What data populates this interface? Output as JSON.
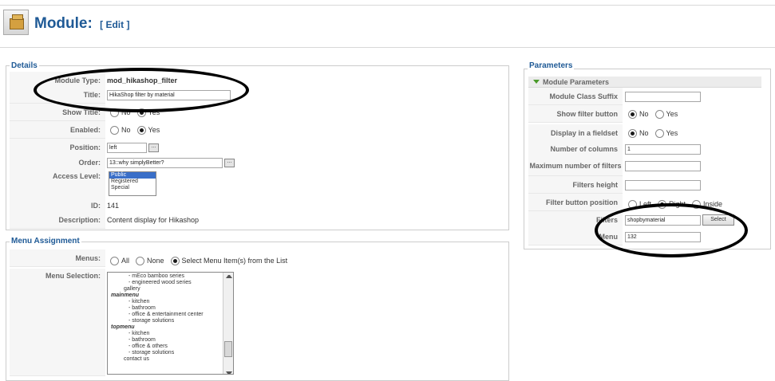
{
  "header": {
    "title": "Module:",
    "edit_label": "[ Edit ]"
  },
  "details": {
    "legend": "Details",
    "module_type_label": "Module Type:",
    "module_type_value": "mod_hikashop_filter",
    "title_label": "Title:",
    "title_value": "HikaShop filter by material",
    "show_title_label": "Show Title:",
    "show_title_no": "No",
    "show_title_yes": "Yes",
    "enabled_label": "Enabled:",
    "enabled_no": "No",
    "enabled_yes": "Yes",
    "position_label": "Position:",
    "position_value": "left",
    "order_label": "Order:",
    "order_value": "13::why simplyBetter?",
    "access_label": "Access Level:",
    "access_options": [
      "Public",
      "Registered",
      "Special"
    ],
    "id_label": "ID:",
    "id_value": "141",
    "description_label": "Description:",
    "description_value": "Content display for Hikashop"
  },
  "menu_assignment": {
    "legend": "Menu Assignment",
    "menus_label": "Menus:",
    "menus_all": "All",
    "menus_none": "None",
    "menus_select": "Select Menu Item(s) from the List",
    "selection_label": "Menu Selection:",
    "items": [
      {
        "text": "- mEco bamboo series",
        "style": "indent"
      },
      {
        "text": "- engineered wood series",
        "style": "indent"
      },
      {
        "text": "gallery",
        "style": "sub"
      },
      {
        "text": "mainmenu",
        "style": "group"
      },
      {
        "text": "- kitchen",
        "style": "indent"
      },
      {
        "text": "- bathroom",
        "style": "indent"
      },
      {
        "text": "- office & entertainment center",
        "style": "indent"
      },
      {
        "text": "- storage solutions",
        "style": "indent"
      },
      {
        "text": "topmenu",
        "style": "group"
      },
      {
        "text": "- kitchen",
        "style": "indent"
      },
      {
        "text": "- bathroom",
        "style": "indent"
      },
      {
        "text": "- office & others",
        "style": "indent"
      },
      {
        "text": "- storage solutions",
        "style": "indent"
      },
      {
        "text": "contact us",
        "style": "sub"
      }
    ]
  },
  "parameters": {
    "legend": "Parameters",
    "section_title": "Module Parameters",
    "class_suffix_label": "Module Class Suffix",
    "class_suffix_value": "",
    "show_filter_button_label": "Show filter button",
    "show_filter_button_no": "No",
    "show_filter_button_yes": "Yes",
    "display_fieldset_label": "Display in a fieldset",
    "display_fieldset_no": "No",
    "display_fieldset_yes": "Yes",
    "columns_label": "Number of columns",
    "columns_value": "1",
    "max_filters_label": "Maximum number of filters",
    "max_filters_value": "",
    "filters_height_label": "Filters height",
    "filters_height_value": "",
    "button_position_label": "Filter button position",
    "button_position_left": "Left",
    "button_position_right": "Right",
    "button_position_inside": "Inside",
    "filters_label": "Filters",
    "filters_value": "shopbymaterial",
    "select_button": "Select",
    "menu_label": "Menu",
    "menu_value": "132"
  }
}
